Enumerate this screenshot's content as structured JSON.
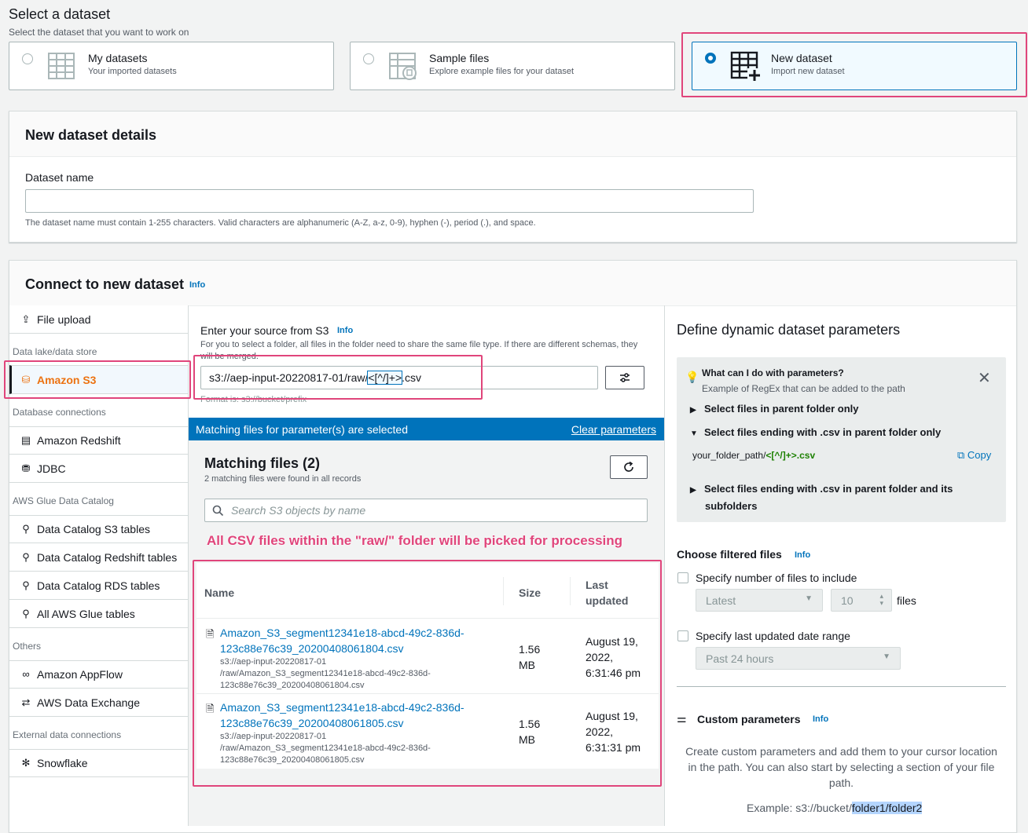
{
  "header": {
    "title": "Select a dataset",
    "subtitle": "Select the dataset that you want to work on"
  },
  "dataset_options": [
    {
      "title": "My datasets",
      "subtitle": "Your imported datasets",
      "selected": false
    },
    {
      "title": "Sample files",
      "subtitle": "Explore example files for your dataset",
      "selected": false
    },
    {
      "title": "New dataset",
      "subtitle": "Import new dataset",
      "selected": true
    }
  ],
  "details": {
    "title": "New dataset details",
    "name_label": "Dataset name",
    "name_value": "",
    "name_hint": "The dataset name must contain 1-255 characters. Valid characters are alphanumeric (A-Z, a-z, 0-9), hyphen (-), period (.), and space."
  },
  "connect": {
    "title": "Connect to new dataset",
    "info": "Info"
  },
  "sidebar": {
    "file_upload": "File upload",
    "group_lake": "Data lake/data store",
    "amazon_s3": "Amazon S3",
    "group_db": "Database connections",
    "redshift": "Amazon Redshift",
    "jdbc": "JDBC",
    "group_glue": "AWS Glue Data Catalog",
    "glue_s3": "Data Catalog S3 tables",
    "glue_redshift": "Data Catalog Redshift tables",
    "glue_rds": "Data Catalog RDS tables",
    "glue_all": "All AWS Glue tables",
    "group_others": "Others",
    "appflow": "Amazon AppFlow",
    "data_exchange": "AWS Data Exchange",
    "group_external": "External data connections",
    "snowflake": "Snowflake"
  },
  "source": {
    "label": "Enter your source from S3",
    "info": "Info",
    "hint": "For you to select a folder, all files in the folder need to share the same file type. If there are different schemas, they will be merged.",
    "path_prefix": "s3://aep-input-20220817-01/raw/",
    "path_param": "<[^/]+>",
    "path_suffix": ".csv",
    "format_hint": "Format is: s3://bucket/prefix"
  },
  "banner": {
    "text": "Matching files for parameter(s) are selected",
    "clear": "Clear parameters"
  },
  "matching": {
    "title": "Matching files (2)",
    "subtitle": "2 matching files were found in all records",
    "search_placeholder": "Search S3 objects by name",
    "annotation": "All CSV files within the \"raw/\" folder will be picked for processing",
    "columns": {
      "name": "Name",
      "size": "Size",
      "updated_1": "Last",
      "updated_2": "updated"
    },
    "rows": [
      {
        "name_1": "Amazon_S3_segment12341e18-abcd-49c2-836d-",
        "name_2": "123c88e76c39_20200408061804.csv",
        "path_1": "s3://aep-input-20220817-01",
        "path_2": "/raw/Amazon_S3_segment12341e18-abcd-49c2-836d-",
        "path_3": "123c88e76c39_20200408061804.csv",
        "size_1": "1.56",
        "size_2": "MB",
        "date_1": "August 19,",
        "date_2": "2022,",
        "date_3": "6:31:46 pm"
      },
      {
        "name_1": "Amazon_S3_segment12341e18-abcd-49c2-836d-",
        "name_2": "123c88e76c39_20200408061805.csv",
        "path_1": "s3://aep-input-20220817-01",
        "path_2": "/raw/Amazon_S3_segment12341e18-abcd-49c2-836d-",
        "path_3": "123c88e76c39_20200408061805.csv",
        "size_1": "1.56",
        "size_2": "MB",
        "date_1": "August 19,",
        "date_2": "2022,",
        "date_3": "6:31:31 pm"
      }
    ]
  },
  "params": {
    "title": "Define dynamic dataset parameters",
    "help_title": "What can I do with parameters?",
    "help_sub": "Example of RegEx that can be added to the path",
    "item1": "Select files in parent folder only",
    "item2": "Select files ending with .csv in parent folder only",
    "example_path": "your_folder_path/",
    "example_regex": "<[^/]+>.csv",
    "copy": "Copy",
    "item3_1": "Select files ending with .csv in parent folder and its",
    "item3_2": "subfolders",
    "filtered_title": "Choose filtered files",
    "filtered_info": "Info",
    "opt_number": "Specify number of files to include",
    "latest": "Latest",
    "count": "10",
    "files": "files",
    "opt_date": "Specify last updated date range",
    "range": "Past 24 hours",
    "custom_title": "Custom parameters",
    "custom_info": "Info",
    "custom_desc_1": "Create custom parameters and add them to your cursor location",
    "custom_desc_2": "in the path. You can also start by selecting a section of your file",
    "custom_desc_3": "path.",
    "example_label": "Example: s3://bucket/",
    "example_sel": "folder1/folder2"
  },
  "colors": {
    "accent": "#0073bb",
    "highlight": "#e0457b",
    "active_nav": "#ec7211",
    "regex_green": "#1d8102"
  }
}
